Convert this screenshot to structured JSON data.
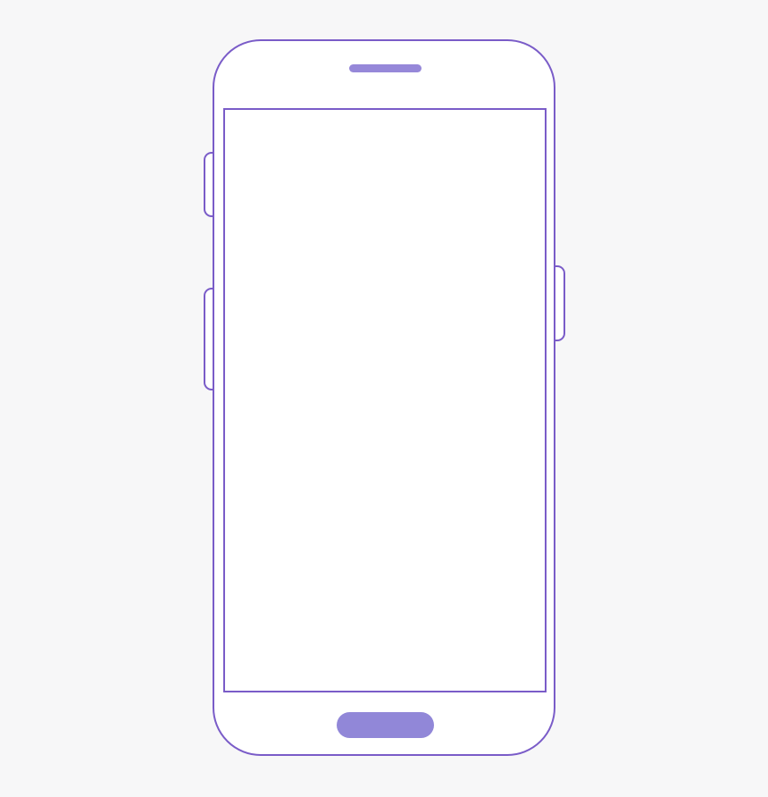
{
  "colors": {
    "background": "#f7f7f8",
    "outline": "#7a5cc8",
    "phone_fill": "#ffffff",
    "accent": "#9187d8"
  },
  "icons": {
    "phone": "smartphone-outline-icon",
    "speaker": "speaker-grille-icon",
    "home": "home-button-icon"
  }
}
